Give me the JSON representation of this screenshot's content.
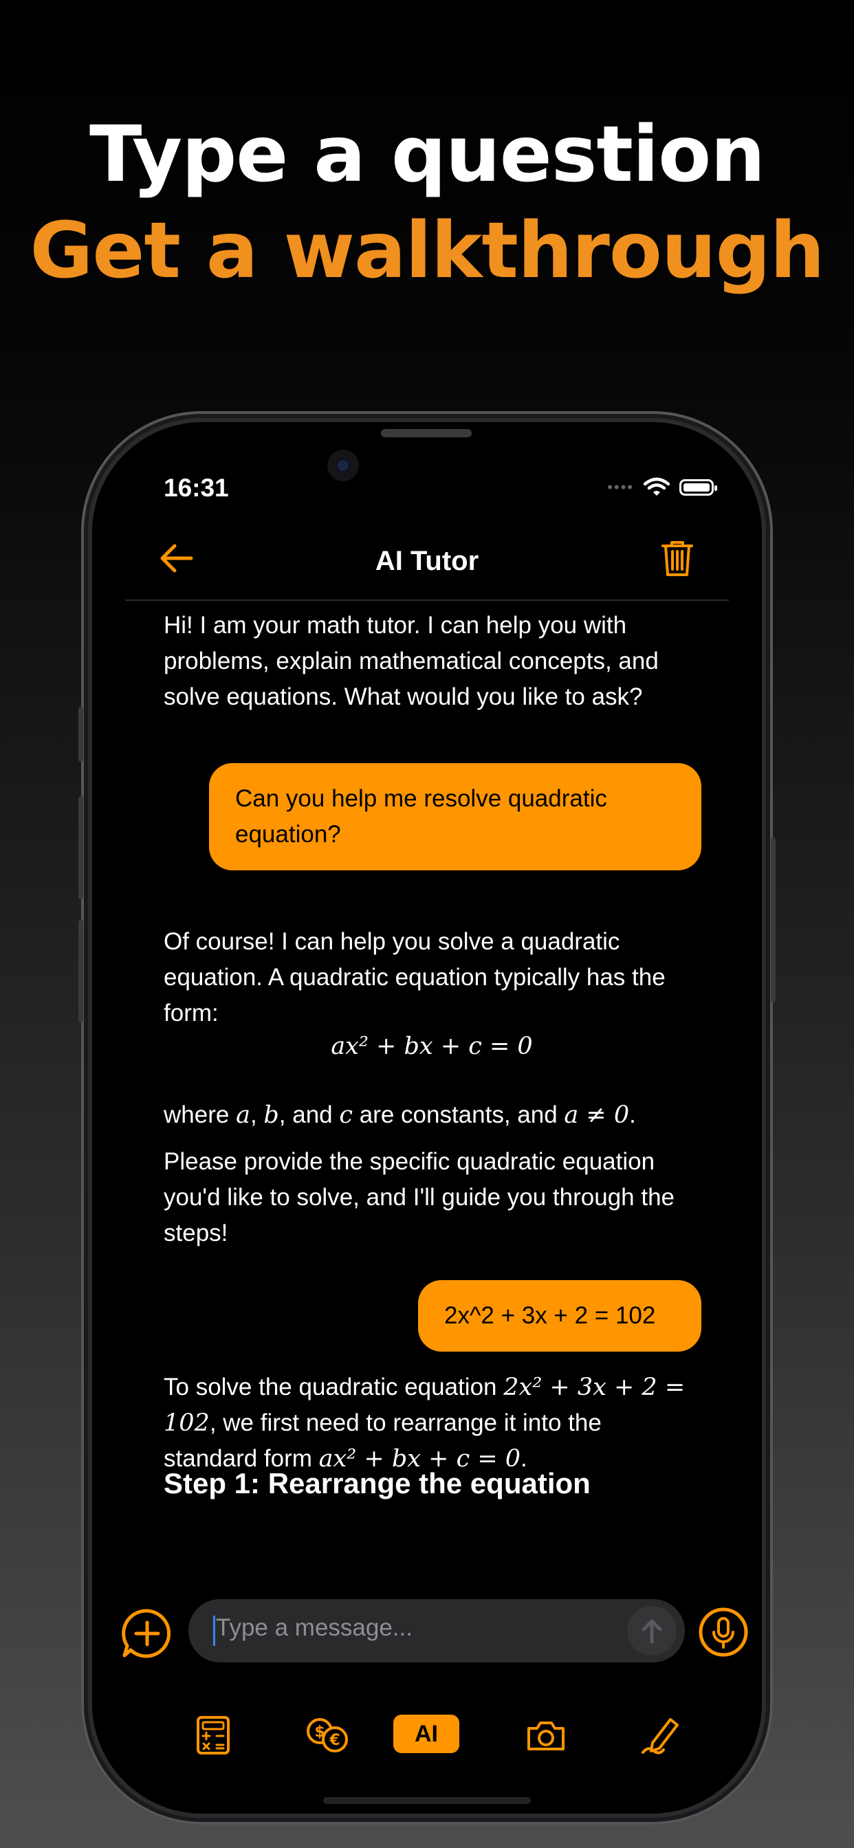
{
  "headline": {
    "line1": "Type a question",
    "line2": "Get a walkthrough",
    "line1_color": "#ffffff",
    "line2_color": "#f0901e"
  },
  "status_bar": {
    "time": "16:31",
    "icons": [
      "cellular-dots-icon",
      "wifi-icon",
      "battery-icon"
    ]
  },
  "nav": {
    "title": "AI Tutor",
    "back_icon": "arrow-left-icon",
    "delete_icon": "trash-icon",
    "accent": "#ff9500"
  },
  "chat": {
    "bot_greeting": "Hi! I am your math tutor. I can help you with problems, explain mathematical concepts, and solve equations. What would you like to ask?",
    "user_question_1": "Can you help me resolve quadratic equation?",
    "bot_reply_intro": "Of course! I can help you solve a quadratic equation. A quadratic equation typically has the form:",
    "bot_reply_formula": "ax² + bx + c = 0",
    "bot_reply_where": {
      "p1": "where ",
      "a": "a",
      "sep1": ", ",
      "b": "b",
      "sep2": ", and ",
      "c": "c",
      "p2": " are constants, and ",
      "cond": "a ≠ 0",
      "end": "."
    },
    "bot_reply_request": "Please provide the specific quadratic equation you'd like to solve, and I'll guide you through the steps!",
    "user_question_2": "2x^2 + 3x + 2 = 102",
    "bot_solve": {
      "p1": "To solve the quadratic equation ",
      "eq1": "2x² + 3x + 2 = 102",
      "p2": ", we first need to rearrange it into the standard form ",
      "eq2": "ax² + bx + c = 0",
      "end": "."
    },
    "step_heading": "Step 1: Rearrange the equation"
  },
  "composer": {
    "placeholder": "Type a message...",
    "add_icon": "plus-bubble-icon",
    "send_icon": "arrow-up-icon",
    "mic_icon": "microphone-icon"
  },
  "tab_bar": {
    "items": [
      {
        "icon": "calculator-icon"
      },
      {
        "icon": "currency-exchange-icon"
      },
      {
        "label": "AI"
      },
      {
        "icon": "camera-icon"
      },
      {
        "icon": "pen-sketch-icon"
      }
    ]
  }
}
